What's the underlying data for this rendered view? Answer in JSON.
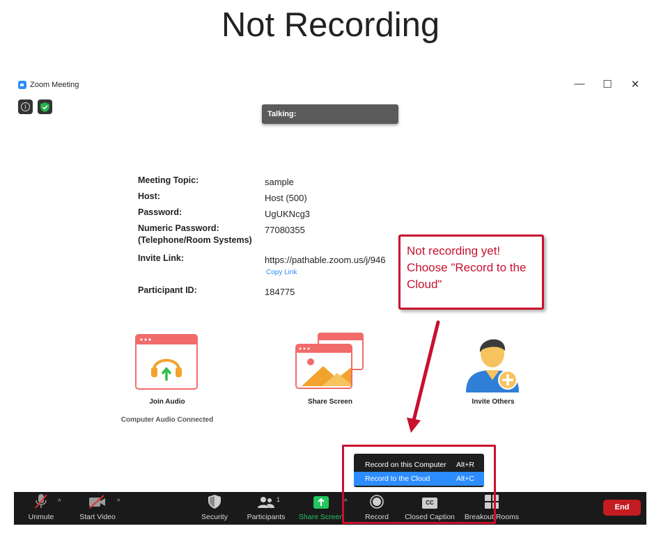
{
  "slide": {
    "title": "Not Recording"
  },
  "window": {
    "title": "Zoom Meeting",
    "controls": {
      "minimize": "—",
      "maximize": "☐",
      "close": "✕"
    }
  },
  "talking": {
    "label": "Talking:"
  },
  "meeting_info": {
    "rows": [
      {
        "label": "Meeting Topic:",
        "value": "sample"
      },
      {
        "label": "Host:",
        "value": "Host (500)"
      },
      {
        "label": "Password:",
        "value": "UgUKNcg3"
      },
      {
        "label": "Numeric Password:",
        "label2": "(Telephone/Room Systems)",
        "value": "77080355"
      },
      {
        "label": "Invite Link:",
        "value": "https://pathable.zoom.us/j/946"
      },
      {
        "label": "Participant ID:",
        "value": "184775"
      }
    ],
    "copy_link": "Copy Link"
  },
  "callout": {
    "lines": [
      "Not recording yet!",
      "Choose \"Record to the",
      "Cloud\""
    ],
    "color": "#c8102e"
  },
  "actions": {
    "join_audio": {
      "label": "Join Audio",
      "status": "Computer Audio Connected",
      "icon": "join-audio-icon"
    },
    "share_screen": {
      "label": "Share Screen",
      "icon": "share-screen-icon"
    },
    "invite_others": {
      "label": "Invite Others",
      "icon": "invite-others-icon"
    }
  },
  "record_menu": {
    "items": [
      {
        "label": "Record on this Computer",
        "shortcut": "Alt+R"
      },
      {
        "label": "Record to the Cloud",
        "shortcut": "Alt+C"
      }
    ]
  },
  "toolbar": {
    "unmute": "Unmute",
    "start_video": "Start Video",
    "security": "Security",
    "participants": "Participants",
    "participants_count": "1",
    "share_screen": "Share Screen",
    "record": "Record",
    "closed_caption": "Closed Caption",
    "closed_caption_glyph": "CC",
    "breakout_rooms": "Breakout Rooms",
    "end": "End"
  },
  "colors": {
    "zoom_blue": "#2D8CFF",
    "toolbar_bg": "#1a1a1a",
    "share_green": "#22c55e",
    "end_red": "#c31c22",
    "annotation_red": "#c8102e"
  }
}
